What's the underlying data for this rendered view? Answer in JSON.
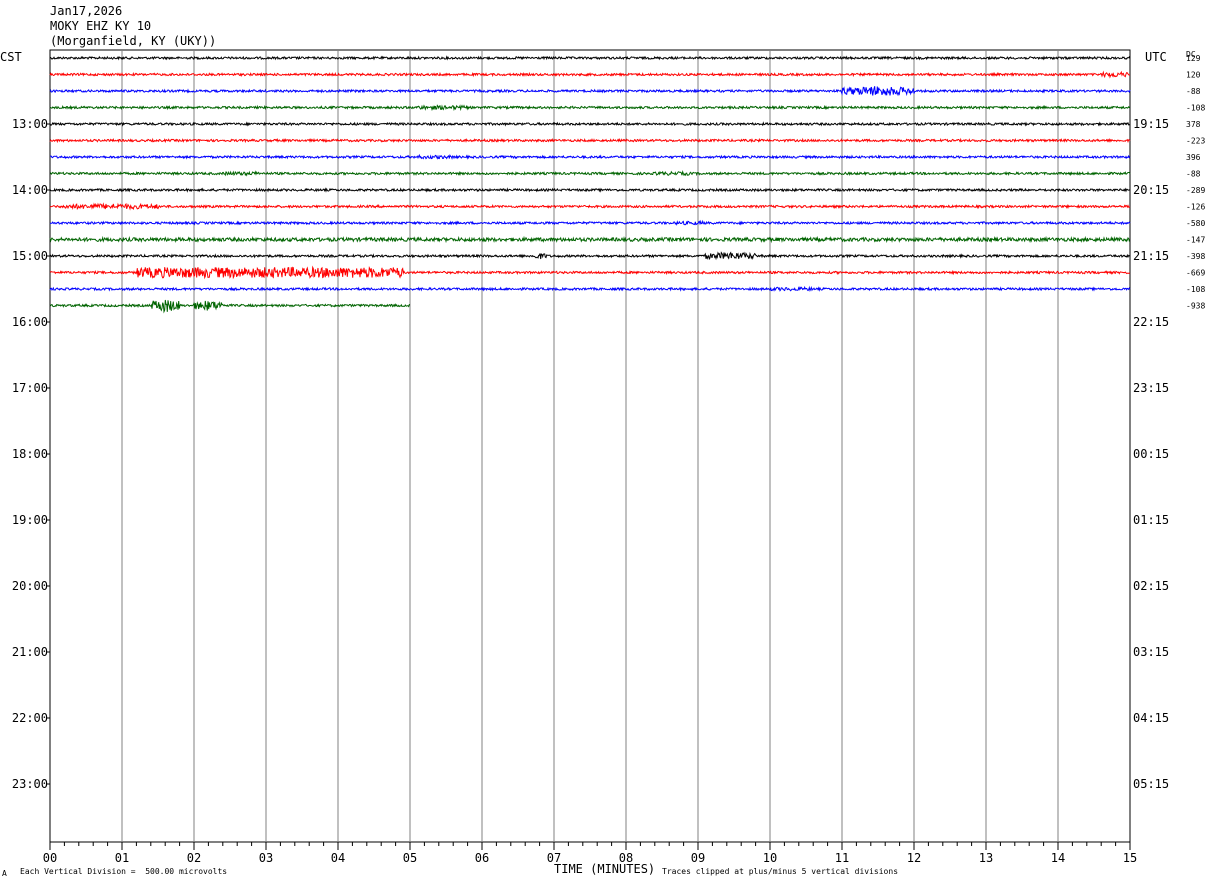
{
  "header": {
    "date": "Jan17,2026",
    "station": "MOKY EHZ KY 10",
    "location": "(Morganfield, KY (UKY))"
  },
  "left_tz": "CST",
  "right_tz": "UTC",
  "dc_label": "DC",
  "footer": {
    "vertical_division": "Each Vertical Division =  500.00 microvolts",
    "xlabel": "TIME (MINUTES)",
    "clip_note": "Traces clipped at plus/minus 5 vertical divisions",
    "corner_mark": "A"
  },
  "colors": {
    "trace_cycle": [
      "#000000",
      "#ff0000",
      "#0000ff",
      "#006400"
    ],
    "grid": "#808080",
    "frame": "#000000"
  },
  "chart_data": {
    "type": "line",
    "title": "MOKY EHZ KY 10",
    "xlabel": "TIME (MINUTES)",
    "ylabel": "",
    "x_ticks": [
      "00",
      "01",
      "02",
      "03",
      "04",
      "05",
      "06",
      "07",
      "08",
      "09",
      "10",
      "11",
      "12",
      "13",
      "14",
      "15"
    ],
    "xlim": [
      0,
      15
    ],
    "grid": true,
    "left_hour_labels": [
      "13:00",
      "14:00",
      "15:00",
      "16:00",
      "17:00",
      "18:00",
      "19:00",
      "20:00",
      "21:00",
      "22:00",
      "23:00"
    ],
    "right_hour_labels": [
      "19:15",
      "20:15",
      "21:15",
      "22:15",
      "23:15",
      "00:15",
      "01:15",
      "02:15",
      "03:15",
      "04:15",
      "05:15"
    ],
    "trace_count": 16,
    "traces_per_hour": 4,
    "dc_offsets": [
      "129",
      "120",
      "-88",
      "-108",
      "378",
      "-223",
      "396",
      "-88",
      "-289",
      "-126",
      "-580",
      "-147",
      "-398",
      "-669",
      "-108",
      "-938"
    ],
    "last_trace_end_minute": 5.0,
    "events": [
      {
        "trace": 1,
        "start_min": 14.6,
        "end_min": 15.0,
        "amp": 1.6
      },
      {
        "trace": 2,
        "start_min": 11.0,
        "end_min": 12.0,
        "amp": 3.0
      },
      {
        "trace": 3,
        "start_min": 5.1,
        "end_min": 5.8,
        "amp": 1.2
      },
      {
        "trace": 6,
        "start_min": 5.1,
        "end_min": 5.6,
        "amp": 1.0
      },
      {
        "trace": 7,
        "start_min": 2.4,
        "end_min": 2.9,
        "amp": 1.0
      },
      {
        "trace": 7,
        "start_min": 8.4,
        "end_min": 8.9,
        "amp": 1.0
      },
      {
        "trace": 9,
        "start_min": 0.2,
        "end_min": 1.5,
        "amp": 1.6
      },
      {
        "trace": 10,
        "start_min": 8.7,
        "end_min": 9.1,
        "amp": 1.0
      },
      {
        "trace": 11,
        "start_min": 0.0,
        "end_min": 15.0,
        "amp": 1.0
      },
      {
        "trace": 12,
        "start_min": 6.7,
        "end_min": 6.9,
        "amp": 1.8
      },
      {
        "trace": 12,
        "start_min": 9.1,
        "end_min": 9.8,
        "amp": 2.2
      },
      {
        "trace": 13,
        "start_min": 1.2,
        "end_min": 4.9,
        "amp": 3.0
      },
      {
        "trace": 14,
        "start_min": 10.0,
        "end_min": 10.6,
        "amp": 1.0
      },
      {
        "trace": 15,
        "start_min": 1.4,
        "end_min": 1.8,
        "amp": 4.0
      },
      {
        "trace": 15,
        "start_min": 2.0,
        "end_min": 2.4,
        "amp": 3.0
      }
    ]
  }
}
